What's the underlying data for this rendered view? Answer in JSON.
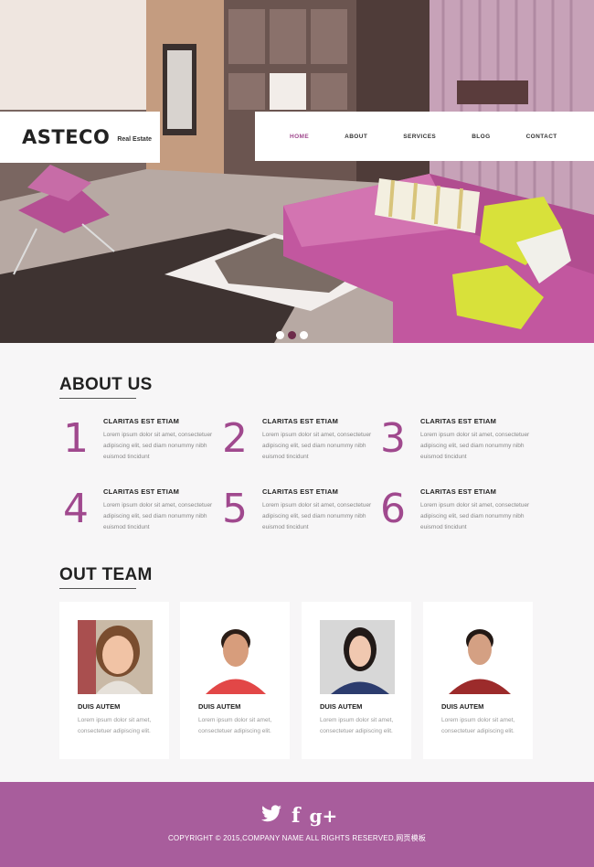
{
  "header": {
    "logo": "ASTECO",
    "logo_sub": "Real Estate",
    "nav": [
      {
        "label": "HOME",
        "active": true
      },
      {
        "label": "ABOUT",
        "active": false
      },
      {
        "label": "SERVICES",
        "active": false
      },
      {
        "label": "BLOG",
        "active": false
      },
      {
        "label": "CONTACT",
        "active": false
      }
    ]
  },
  "slider": {
    "dots": 3,
    "active_index": 1
  },
  "about": {
    "title": "ABOUT US",
    "items": [
      {
        "num": "1",
        "title": "CLARITAS EST ETIAM",
        "desc": "Lorem ipsum dolor sit amet, consectetuer adipiscing elit, sed diam nonummy nibh euismod tincidunt"
      },
      {
        "num": "2",
        "title": "CLARITAS EST ETIAM",
        "desc": "Lorem ipsum dolor sit amet, consectetuer adipiscing elit, sed diam nonummy nibh euismod tincidunt"
      },
      {
        "num": "3",
        "title": "CLARITAS EST ETIAM",
        "desc": "Lorem ipsum dolor sit amet, consectetuer adipiscing elit, sed diam nonummy nibh euismod tincidunt"
      },
      {
        "num": "4",
        "title": "CLARITAS EST ETIAM",
        "desc": "Lorem ipsum dolor sit amet, consectetuer adipiscing elit, sed diam nonummy nibh euismod tincidunt"
      },
      {
        "num": "5",
        "title": "CLARITAS EST ETIAM",
        "desc": "Lorem ipsum dolor sit amet, consectetuer adipiscing elit, sed diam nonummy nibh euismod tincidunt"
      },
      {
        "num": "6",
        "title": "CLARITAS EST ETIAM",
        "desc": "Lorem ipsum dolor sit amet, consectetuer adipiscing elit, sed diam nonummy nibh euismod tincidunt"
      }
    ]
  },
  "team": {
    "title": "OUT TEAM",
    "members": [
      {
        "name": "DUIS AUTEM",
        "desc": "Lorem ipsum dolor sit amet, consectetuer adipiscing elit."
      },
      {
        "name": "DUIS AUTEM",
        "desc": "Lorem ipsum dolor sit amet, consectetuer adipiscing elit."
      },
      {
        "name": "DUIS AUTEM",
        "desc": "Lorem ipsum dolor sit amet, consectetuer adipiscing elit."
      },
      {
        "name": "DUIS AUTEM",
        "desc": "Lorem ipsum dolor sit amet, consectetuer adipiscing elit."
      }
    ]
  },
  "footer": {
    "social": [
      "twitter-icon",
      "facebook-icon",
      "google-plus-icon"
    ],
    "copyright": "COPYRIGHT © 2015,COMPANY NAME ALL RIGHTS RESERVED.",
    "copyright_cn": "网页模板"
  },
  "colors": {
    "accent": "#a0498e",
    "footer": "#a85d9c",
    "sofa": "#c2579f",
    "cushion": "#d8e13a"
  }
}
